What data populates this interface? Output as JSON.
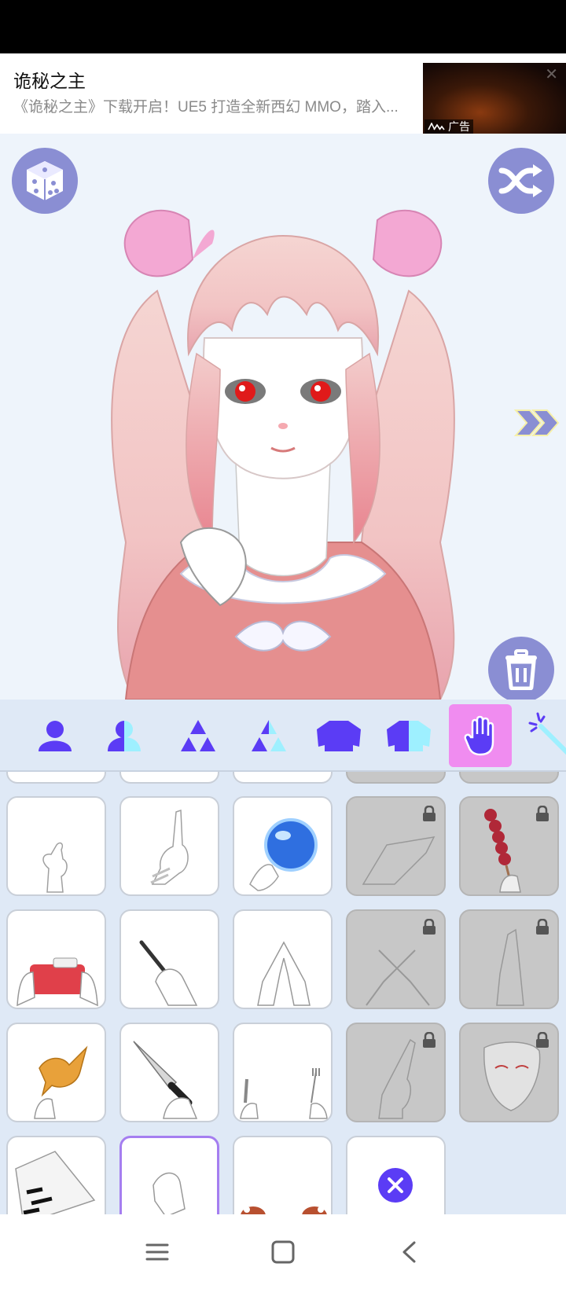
{
  "ad": {
    "title": "诡秘之主",
    "description": "《诡秘之主》下载开启！UE5 打造全新西幻 MMO，踏入...",
    "label": "广告",
    "close_icon": "close-icon"
  },
  "toolbar": {
    "random_icon": "dice-icon",
    "shuffle_icon": "shuffle-icon",
    "next_icon": "double-chevron-right-icon",
    "delete_icon": "trash-icon"
  },
  "categories": [
    {
      "id": "body",
      "icon": "body-icon"
    },
    {
      "id": "body-color",
      "icon": "body-split-icon"
    },
    {
      "id": "pattern",
      "icon": "triangles-icon"
    },
    {
      "id": "pattern-color",
      "icon": "triangles-split-icon"
    },
    {
      "id": "top",
      "icon": "sweater-icon"
    },
    {
      "id": "top-color",
      "icon": "sweater-split-icon"
    },
    {
      "id": "hands",
      "icon": "hand-icon",
      "active": true
    },
    {
      "id": "effects",
      "icon": "magic-wand-icon"
    }
  ],
  "items": [
    {
      "name": "finger-heart",
      "locked": false
    },
    {
      "name": "pointing-bandaged",
      "locked": false
    },
    {
      "name": "crystal-ball",
      "locked": false
    },
    {
      "name": "crossed-hands",
      "locked": true
    },
    {
      "name": "candied-haws",
      "locked": true
    },
    {
      "name": "camera",
      "locked": false
    },
    {
      "name": "phone",
      "locked": false
    },
    {
      "name": "heart-hands",
      "locked": false
    },
    {
      "name": "crossed-fingers",
      "locked": true
    },
    {
      "name": "raised-hand",
      "locked": true
    },
    {
      "name": "bird",
      "locked": false
    },
    {
      "name": "knife",
      "locked": false
    },
    {
      "name": "knife-and-fork",
      "locked": false
    },
    {
      "name": "pointing-up",
      "locked": true
    },
    {
      "name": "mask",
      "locked": true
    },
    {
      "name": "fan",
      "locked": false
    },
    {
      "name": "hand-pose",
      "locked": false,
      "selected": true
    },
    {
      "name": "paws",
      "locked": false
    },
    {
      "name": "none",
      "locked": false
    }
  ],
  "colors": {
    "accent": "#5b3cf5",
    "accent_light": "#9ef0ff",
    "button": "#8a8ed3",
    "active_tab": "#f08cf0",
    "background": "#eef4fb"
  },
  "nav": {
    "menu_icon": "menu-icon",
    "home_icon": "home-icon",
    "back_icon": "back-icon"
  }
}
